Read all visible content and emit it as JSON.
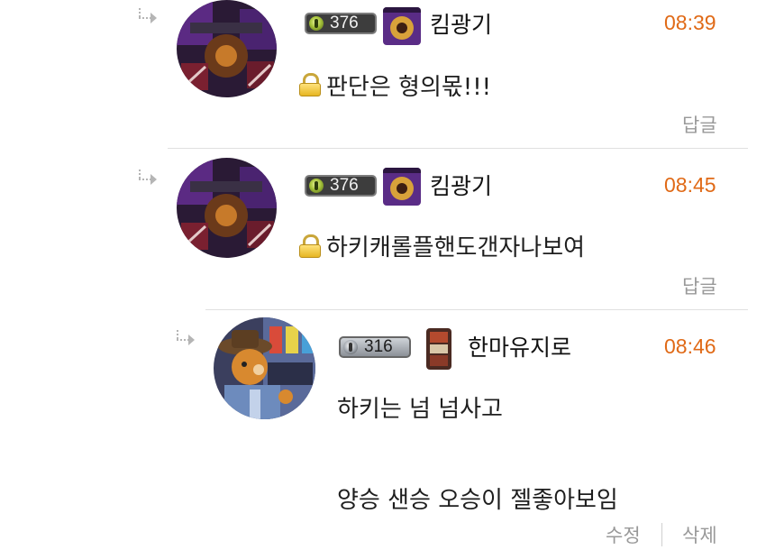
{
  "comments": [
    {
      "level": "376",
      "nickname": "킴광기",
      "time": "08:39",
      "secret": true,
      "text": "판단은 형의몫!!!",
      "reply_label": "답글"
    },
    {
      "level": "376",
      "nickname": "킴광기",
      "time": "08:45",
      "secret": true,
      "text": "하키캐롤플핸도갠자나보여",
      "reply_label": "답글"
    },
    {
      "level": "316",
      "nickname": "한마유지로",
      "time": "08:46",
      "secret": false,
      "text_lines": [
        "하키는 넘 넘사고",
        "양승 샌승 오승이 젤좋아보임"
      ],
      "edit_label": "수정",
      "delete_label": "삭제"
    }
  ],
  "icons": {
    "reply_arrow": "reply-arrow-icon",
    "lock": "lock-icon",
    "level_gem": "level-gem-icon"
  },
  "colors": {
    "time": "#e06a17",
    "action_text": "#999999",
    "lock": "#e6b623"
  }
}
